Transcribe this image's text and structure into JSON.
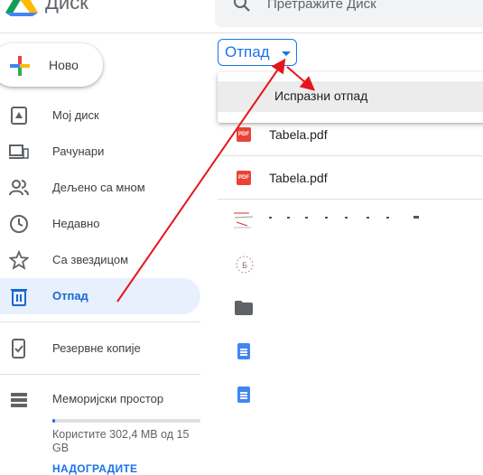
{
  "header": {
    "title": "Диск",
    "search_placeholder": "Претражите Диск"
  },
  "new_button": {
    "label": "Ново"
  },
  "sidebar": {
    "items": [
      {
        "label": "Мој диск",
        "icon": "drive-icon"
      },
      {
        "label": "Рачунари",
        "icon": "computer-icon"
      },
      {
        "label": "Дељено са мном",
        "icon": "people-icon"
      },
      {
        "label": "Недавно",
        "icon": "clock-icon"
      },
      {
        "label": "Са звездицом",
        "icon": "star-icon"
      },
      {
        "label": "Отпад",
        "icon": "trash-icon",
        "active": true
      }
    ],
    "backups": {
      "label": "Резервне копије",
      "icon": "backup-icon"
    },
    "storage": {
      "label": "Меморијски простор",
      "usage_text": "Користите 302,4 MB од 15 GB",
      "used_fraction": 0.02,
      "upgrade_label": "НАДОГРАДИТЕ"
    }
  },
  "breadcrumb": {
    "label": "Отпад"
  },
  "dropdown": {
    "items": [
      {
        "label": "Испразни отпад"
      }
    ]
  },
  "files": [
    {
      "name": "Tabela.pdf",
      "type": "pdf"
    },
    {
      "name": "Tabela.pdf",
      "type": "pdf"
    },
    {
      "name": "",
      "type": "image"
    },
    {
      "name": "",
      "type": "image"
    },
    {
      "name": "",
      "type": "folder"
    },
    {
      "name": "",
      "type": "doc"
    },
    {
      "name": "",
      "type": "doc"
    }
  ],
  "colors": {
    "accent": "#1a73e8",
    "annotation": "#e8141b",
    "active_bg": "#e8f0fe"
  }
}
